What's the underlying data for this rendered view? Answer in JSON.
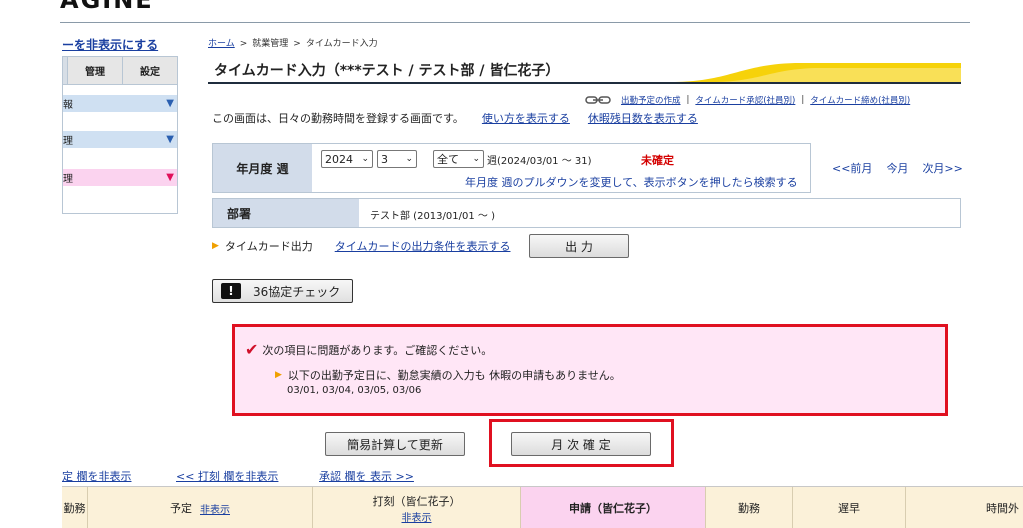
{
  "header": {
    "logo_text": "AGINE"
  },
  "sidebar": {
    "toggle_label": "ーを非表示にする",
    "tabs": [
      "管理",
      "設定"
    ],
    "rows": [
      {
        "label": "報",
        "color": "#cfe0f2",
        "tri_color": "#2a5fb0"
      },
      {
        "label": "理",
        "color": "#cfe0f2",
        "tri_color": "#2a5fb0"
      },
      {
        "label": "理",
        "color": "#fbd3ef",
        "tri_color": "#e0105a"
      }
    ]
  },
  "breadcrumb": {
    "home": "ホーム",
    "sep": ">",
    "section": "就業管理",
    "current": "タイムカード入力"
  },
  "title": {
    "text": "タイムカード入力（***テスト / テスト部 / 皆仁花子）"
  },
  "top_links": [
    "出勤予定の作成",
    "タイムカード承認(社員別)",
    "タイムカード締め(社員別)"
  ],
  "description": {
    "text": "この画面は、日々の勤務時間を登録する画面です。",
    "howto_link": "使い方を表示する",
    "leave_link": "休暇残日数を表示する"
  },
  "period": {
    "label": "年月度 週",
    "year": "2024",
    "month": "3",
    "week": "全て",
    "week_text": "週(2024/03/01 ～ 31)",
    "status": "未確定",
    "hint": "年月度 週のプルダウンを変更して、表示ボタンを押したら検索する"
  },
  "month_nav": {
    "prev": "<<前月",
    "current": "今月",
    "next": "次月>>"
  },
  "department": {
    "label": "部署",
    "value": "テスト部 (2013/01/01 ～ )"
  },
  "timecard_output": {
    "label": "タイムカード出力",
    "link": "タイムカードの出力条件を表示する",
    "button": "出 力"
  },
  "check36": {
    "icon": "!",
    "label": "36協定チェック"
  },
  "alert": {
    "heading": "次の項目に問題があります。ご確認ください。",
    "item": "以下の出勤予定日に、勤怠実績の入力も 休暇の申請もありません。",
    "dates": "03/01, 03/04, 03/05, 03/06"
  },
  "actions": {
    "simple_calc": "簡易計算して更新",
    "monthly_confirm": "月 次 確 定"
  },
  "column_links": {
    "schedule": "定 欄を非表示",
    "stamp": "<< 打刻 欄を非表示",
    "approval": "承認 欄を 表示 >>"
  },
  "table_header": {
    "col0": "勤務",
    "schedule": "予定",
    "schedule_toggle": "非表示",
    "stamp": "打刻（皆仁花子）",
    "stamp_toggle": "非表示",
    "request": "申請（皆仁花子）",
    "work": "勤務",
    "late": "遅早",
    "overtime": "時間外"
  }
}
